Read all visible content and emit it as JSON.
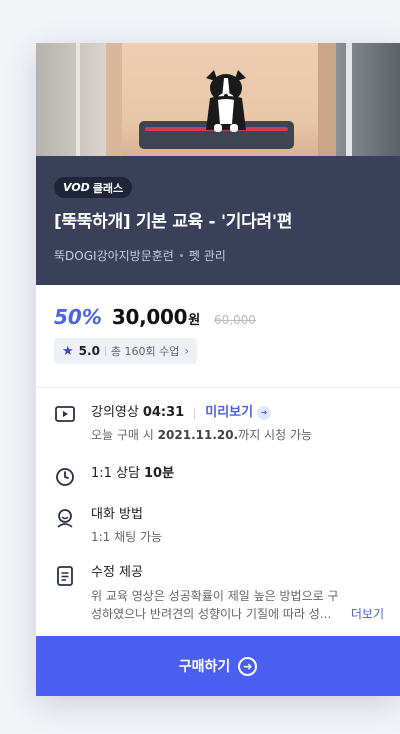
{
  "course": {
    "badge_vod": "VOD",
    "badge_class": "클래스",
    "title": "[뚝뚝하개] 기본 교육 - '기다려'편",
    "trainer": "뚝DOGI강아지방문훈련",
    "category": "펫 관리"
  },
  "price": {
    "discount": "50%",
    "amount": "30,000",
    "currency": "원",
    "original": "60,000"
  },
  "rating": {
    "score": "5.0",
    "count_text": "총 160회 수업"
  },
  "details": {
    "video": {
      "label": "강의영상",
      "duration": "04:31",
      "preview": "미리보기",
      "sub_prefix": "오늘 구매 시",
      "date": "2021.11.20.",
      "sub_suffix": "까지 시청 가능"
    },
    "consult": {
      "label": "1:1 상담",
      "duration": "10분"
    },
    "chat": {
      "label": "대화 방법",
      "sub": "1:1 채팅 가능"
    },
    "revise": {
      "label": "수정 제공",
      "sub1": "위 교육 영상은 성공확률이 제일 높은 방법으로 구",
      "sub2": "성하였으나 반려견의 성향이나 기질에 따라 성...",
      "more": "더보기"
    }
  },
  "cta": {
    "label": "구매하기"
  },
  "icons": {
    "play": "play-icon",
    "clock": "clock-icon",
    "person": "person-icon",
    "document": "document-icon"
  },
  "colors": {
    "accent": "#4a63e8",
    "band": "#3a3f5a",
    "cta": "#4a5ff0"
  }
}
